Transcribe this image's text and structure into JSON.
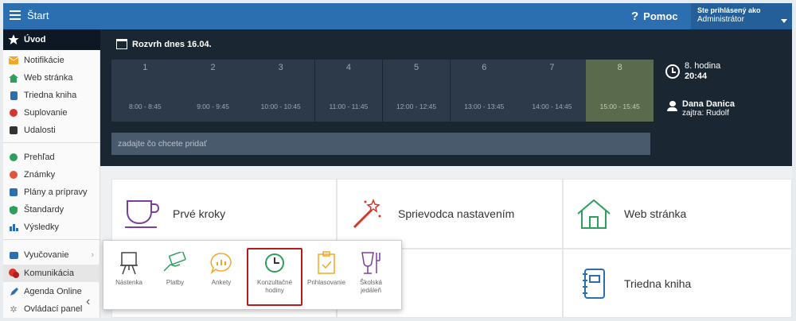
{
  "topbar": {
    "title": "Štart",
    "help_label": "Pomoc",
    "help_glyph": "?",
    "user_line1": "Ste prihlásený ako",
    "user_line2": "Administrátor"
  },
  "sidebar": {
    "items": [
      {
        "label": "Úvod",
        "icon": "star-icon",
        "color": "#ffffff"
      },
      {
        "label": "Notifikácie",
        "icon": "envelope-icon",
        "color": "#f5a623"
      },
      {
        "label": "Web stránka",
        "icon": "home-icon",
        "color": "#2e9e5b"
      },
      {
        "label": "Triedna kniha",
        "icon": "book-icon",
        "color": "#2c6fb0"
      },
      {
        "label": "Suplovanie",
        "icon": "user-swap-icon",
        "color": "#d9342b"
      },
      {
        "label": "Udalosti",
        "icon": "calendar-icon",
        "color": "#333333"
      },
      {
        "label": "Prehľad",
        "icon": "check-circle-icon",
        "color": "#2e9e5b"
      },
      {
        "label": "Známky",
        "icon": "grade-icon",
        "color": "#e0553b"
      },
      {
        "label": "Plány a prípravy",
        "icon": "folder-icon",
        "color": "#2c6fb0"
      },
      {
        "label": "Štandardy",
        "icon": "shield-icon",
        "color": "#2e9e5b"
      },
      {
        "label": "Výsledky",
        "icon": "bar-chart-icon",
        "color": "#2c6fb0"
      },
      {
        "label": "Vyučovanie",
        "icon": "briefcase-icon",
        "color": "#2c6fb0"
      },
      {
        "label": "Komunikácia",
        "icon": "chat-icon",
        "color": "#d9342b"
      },
      {
        "label": "Agenda Online",
        "icon": "pen-icon",
        "color": "#2c6fb0"
      },
      {
        "label": "Ovládací panel",
        "icon": "gear-icon",
        "color": "#888888"
      }
    ],
    "collapse_glyph": "‹"
  },
  "schedule": {
    "title": "Rozvrh dnes 16.04.",
    "periods": [
      {
        "num": "1",
        "time": "8:00 - 8:45"
      },
      {
        "num": "2",
        "time": "9:00 - 9:45"
      },
      {
        "num": "3",
        "time": "10:00 - 10:45"
      },
      {
        "num": "4",
        "time": "11:00 - 11:45"
      },
      {
        "num": "5",
        "time": "12:00 - 12:45"
      },
      {
        "num": "6",
        "time": "13:00 - 13:45"
      },
      {
        "num": "7",
        "time": "14:00 - 14:45"
      },
      {
        "num": "8",
        "time": "15:00 - 15:45"
      }
    ],
    "current_period": "8",
    "hour_label": "8. hodina",
    "hour_time": "20:44",
    "teacher_name": "Dana Danica",
    "teacher_sub": "zajtra: Rudolf",
    "input_placeholder": "zadajte čo chcete pridať"
  },
  "tiles": [
    {
      "label": "Prvé kroky",
      "icon": "cup-icon",
      "color": "#7b3fa0"
    },
    {
      "label": "Sprievodca nastavením",
      "icon": "magic-wand-icon",
      "color": "#d9342b"
    },
    {
      "label": "Web stránka",
      "icon": "house-outline-icon",
      "color": "#2e9e5b"
    },
    {
      "label": "",
      "icon": "",
      "color": ""
    },
    {
      "label": "",
      "icon": "",
      "color": ""
    },
    {
      "label": "Triedna kniha",
      "icon": "notebook-icon",
      "color": "#2c6fb0"
    }
  ],
  "popup": {
    "items": [
      {
        "label": "Nástenka",
        "icon": "board-icon",
        "color": "#444444"
      },
      {
        "label": "Platby",
        "icon": "money-hand-icon",
        "color": "#2e9e5b"
      },
      {
        "label": "Ankety",
        "icon": "poll-chat-icon",
        "color": "#f5a623"
      },
      {
        "label": "Konzultačné hodiny",
        "icon": "clock-icon",
        "color": "#2e9e5b"
      },
      {
        "label": "Prihlasovanie",
        "icon": "clipboard-check-icon",
        "color": "#f5a623"
      },
      {
        "label": "Školská jedáleň",
        "icon": "cutlery-icon",
        "color": "#7b3fa0"
      }
    ],
    "selected": "Konzultačné hodiny"
  }
}
